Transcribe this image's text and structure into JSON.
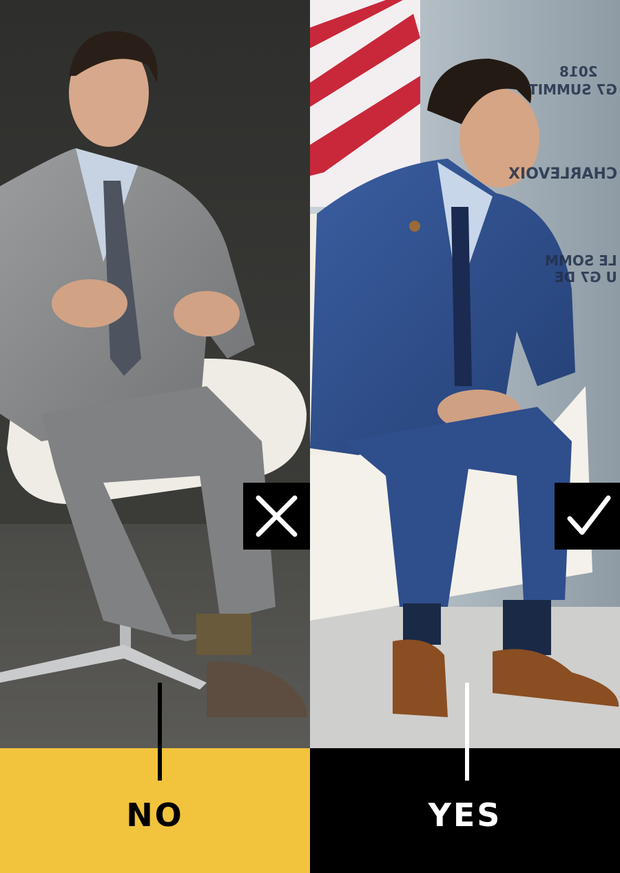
{
  "left_panel": {
    "verdict_label": "NO",
    "badge_icon": "x-mark-icon",
    "band_color": "#f2c33c",
    "label_color": "#000000"
  },
  "right_panel": {
    "verdict_label": "YES",
    "badge_icon": "checkmark-icon",
    "band_color": "#000000",
    "label_color": "#ffffff",
    "backdrop_text": {
      "year": "2018",
      "summit": "G7 SUMMIT",
      "location": "CHARLEVOIX",
      "french_line_1": "LE SOMM",
      "french_line_2": "U G7 DE"
    }
  },
  "colors": {
    "grey_suit": "#8a8c8e",
    "blue_suit": "#2b4a86",
    "brown_shoes": "#8a4e22",
    "cream_chair": "#f2efe8"
  }
}
